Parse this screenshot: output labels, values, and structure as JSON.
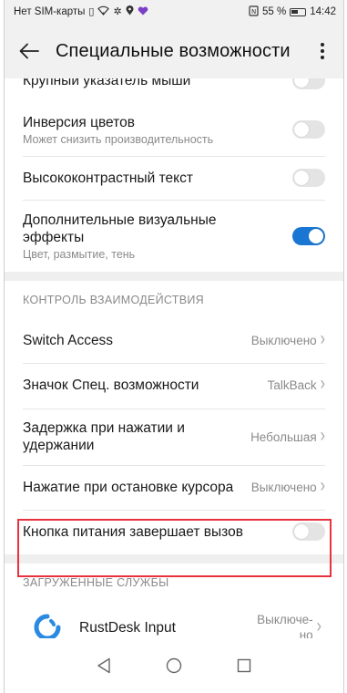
{
  "status_bar": {
    "carrier": "Нет SIM-карты",
    "battery": "55 %",
    "time": "14:42"
  },
  "header": {
    "title": "Специальные возможности"
  },
  "items": {
    "mouse_pointer": {
      "label": "Крупный указатель мыши",
      "enabled": false
    },
    "color_inversion": {
      "label": "Инверсия цветов",
      "sub": "Может снизить производительность",
      "enabled": false
    },
    "high_contrast": {
      "label": "Высококонтрастный текст",
      "enabled": false
    },
    "visual_effects": {
      "label_line1": "Дополнительные визуальные",
      "label_line2": "эффекты",
      "sub": "Цвет, размытие, тень",
      "enabled": true
    }
  },
  "section_interaction": {
    "title": "КОНТРОЛЬ ВЗАИМОДЕЙСТВИЯ",
    "switch_access": {
      "label": "Switch Access",
      "value": "Выключено"
    },
    "shortcut": {
      "label": "Значок Спец. возможности",
      "value": "TalkBack"
    },
    "touch_hold": {
      "label_line1": "Задержка при нажатии и",
      "label_line2": "удержании",
      "value": "Небольшая"
    },
    "dwell_click": {
      "label": "Нажатие при остановке курсора",
      "value": "Выключено"
    },
    "power_ends_call": {
      "label": "Кнопка питания завершает вызов",
      "enabled": false
    }
  },
  "section_services": {
    "title": "ЗАГРУЖЕННЫЕ СЛУЖБЫ",
    "rustdesk": {
      "label": "RustDesk Input",
      "value_line1": "Выключе-",
      "value_line2": "но"
    }
  },
  "colors": {
    "accent": "#1976d2",
    "highlight": "#e8333f",
    "rustdesk_icon": "#2a8ae2"
  }
}
